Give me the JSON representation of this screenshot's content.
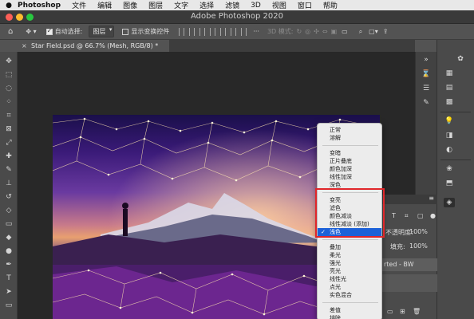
{
  "menubar": {
    "apple_icon": "apple-icon",
    "app_name": "Photoshop",
    "items": [
      "文件",
      "编辑",
      "图像",
      "图层",
      "文字",
      "选择",
      "滤镜",
      "3D",
      "视图",
      "窗口",
      "帮助"
    ]
  },
  "window": {
    "title": "Adobe Photoshop 2020"
  },
  "options": {
    "auto_select_label": "自动选择:",
    "auto_select_value": "图层",
    "show_transform_label": "显示变换控件",
    "mode_3d_label": "3D 模式:"
  },
  "document": {
    "tab_title": "Star Field.psd @ 66.7% (Mesh, RGB/8) *",
    "close_icon": "×"
  },
  "layers_panel": {
    "opacity_label": "不透明度:",
    "opacity_value": "100%",
    "fill_label": "填充:",
    "fill_value": "100%",
    "layer_name": "rted - BW"
  },
  "blend_menu": {
    "groups": [
      [
        "正常",
        "溶解"
      ],
      [
        "变暗",
        "正片叠底",
        "颜色加深",
        "线性加深",
        "深色"
      ],
      [
        "变亮",
        "滤色",
        "颜色减淡",
        "线性减淡 (添加)",
        "浅色"
      ],
      [
        "叠加",
        "柔光",
        "强光",
        "亮光",
        "线性光",
        "点光",
        "实色混合"
      ],
      [
        "差值",
        "排除"
      ]
    ],
    "selected": "浅色",
    "checkmark": "✓"
  },
  "colors": {
    "selection_blue": "#1d61d8",
    "highlight_red": "#e0262a",
    "panel_gray": "#535353"
  }
}
